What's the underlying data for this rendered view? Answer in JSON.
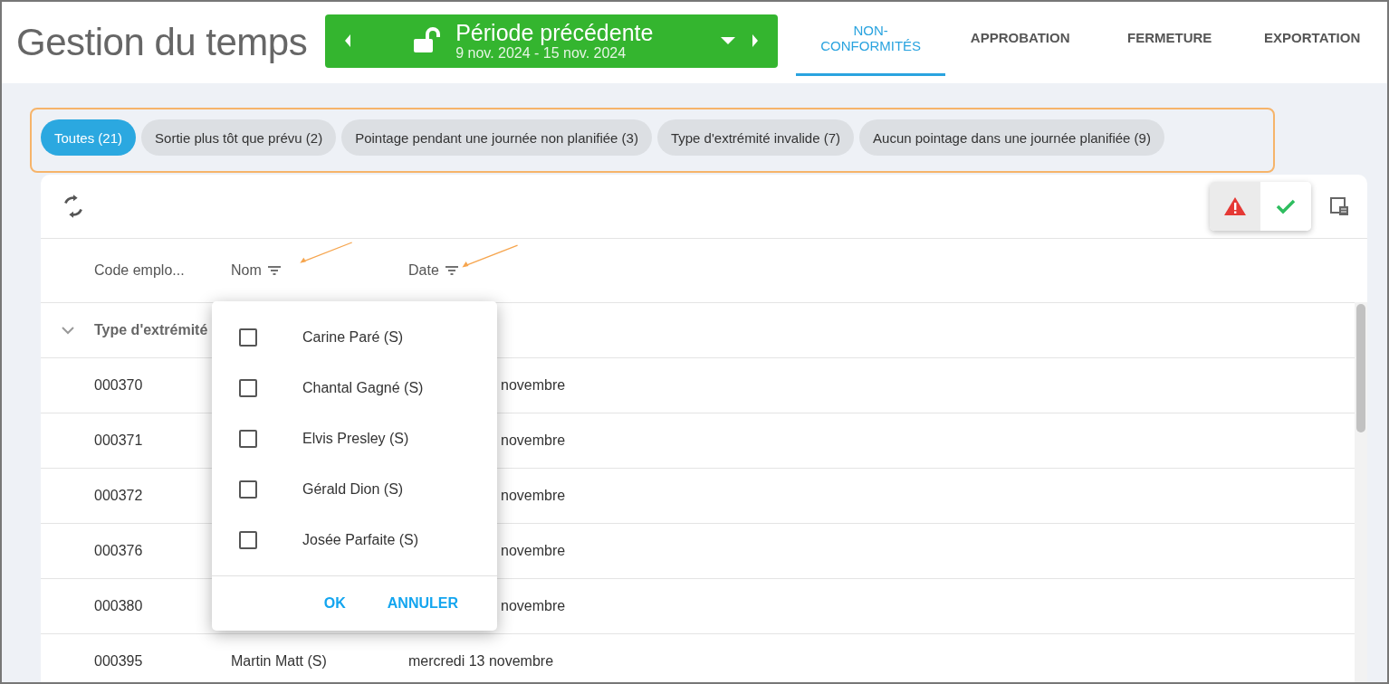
{
  "app_title": "Gestion du temps",
  "period": {
    "label": "Période précédente",
    "range": "9 nov. 2024 - 15 nov. 2024"
  },
  "tabs": [
    {
      "label": "NON-\nCONFORMITÉS",
      "selected": true
    },
    {
      "label": "APPROBATION",
      "selected": false
    },
    {
      "label": "FERMETURE",
      "selected": false
    },
    {
      "label": "EXPORTATION",
      "selected": false
    }
  ],
  "chips": [
    {
      "label": "Toutes (21)",
      "selected": true
    },
    {
      "label": "Sortie plus tôt que prévu (2)",
      "selected": false
    },
    {
      "label": "Pointage pendant une journée non planifiée (3)",
      "selected": false
    },
    {
      "label": "Type d'extrémité invalide (7)",
      "selected": false
    },
    {
      "label": "Aucun pointage dans une journée planifiée (9)",
      "selected": false
    }
  ],
  "toggles": [
    {
      "kind": "warning",
      "selected": true
    },
    {
      "kind": "check",
      "selected": false
    }
  ],
  "table": {
    "columns": [
      "Code emplo...",
      "Nom",
      "Date"
    ],
    "group": "Type d'extrémité",
    "rows": [
      {
        "code": "000370",
        "name": "",
        "date": "novembre"
      },
      {
        "code": "000371",
        "name": "",
        "date": "novembre"
      },
      {
        "code": "000372",
        "name": "",
        "date": "novembre"
      },
      {
        "code": "000376",
        "name": "",
        "date": "novembre"
      },
      {
        "code": "000380",
        "name": "",
        "date": "novembre"
      },
      {
        "code": "000395",
        "name": "Martin Matt (S)",
        "date": "mercredi 13 novembre"
      }
    ]
  },
  "name_filter": {
    "options": [
      {
        "label": "Carine Paré (S)",
        "checked": false
      },
      {
        "label": "Chantal Gagné (S)",
        "checked": false
      },
      {
        "label": "Elvis Presley (S)",
        "checked": false
      },
      {
        "label": "Gérald Dion (S)",
        "checked": false
      },
      {
        "label": "Josée Parfaite (S)",
        "checked": false
      }
    ],
    "buttons": [
      "OK",
      "ANNULER"
    ]
  }
}
